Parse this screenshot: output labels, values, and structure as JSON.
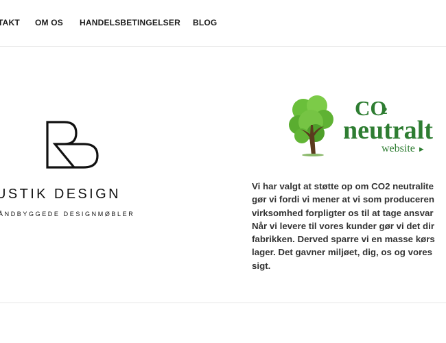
{
  "nav": {
    "items": [
      "TAKT",
      "OM OS",
      "HANDELSBETINGELSER",
      "BLOG"
    ]
  },
  "brand": {
    "name": "USTIK DESIGN",
    "tagline": "ÅNDBYGGEDE DESIGNMØBLER",
    "logo_icon": "rd-monogram-icon"
  },
  "co2_badge": {
    "co": "CO",
    "sub": "2",
    "neutral": "neutralt",
    "website": "website",
    "tree_icon": "tree-icon",
    "color": "#2e7d32"
  },
  "info": {
    "lines": [
      "Vi har valgt at støtte op om CO2 neutralite",
      "gør vi fordi vi mener at vi som produceren",
      "virksomhed forpligter os til at tage ansvar",
      "Når vi levere til vores kunder gør vi det dir",
      "fabrikken. Derved sparre vi en masse kørs",
      "lager. Det gavner miljøet, dig, os og vores",
      "sigt."
    ]
  }
}
